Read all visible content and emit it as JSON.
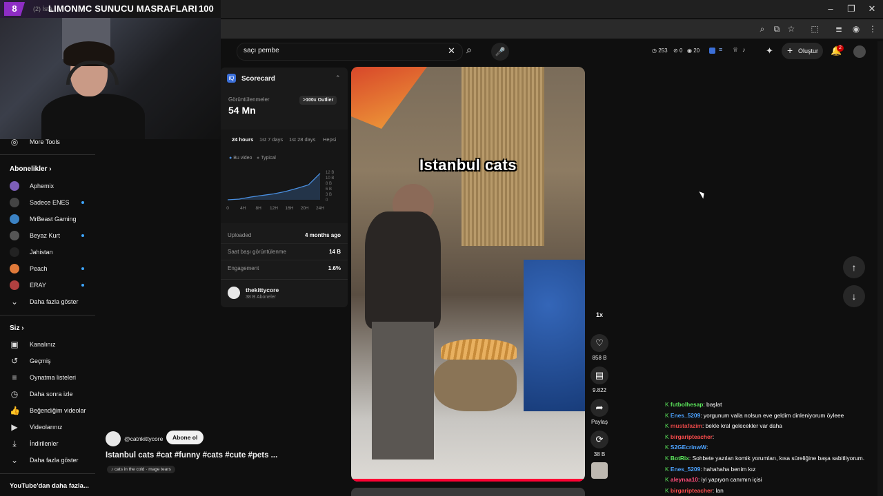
{
  "overlay": {
    "level": "8",
    "title": "LIMONMC SUNUCU MASRAFLARI",
    "count": "100",
    "tab_hint": "(2) İsta"
  },
  "window": {
    "minimize": "–",
    "restore": "❐",
    "close": "✕"
  },
  "search": {
    "query": "saçı pembe"
  },
  "header": {
    "stat1": "253",
    "stat2": "0",
    "stat3": "20",
    "create_label": "Oluştur",
    "notif_count": "2"
  },
  "scorecard": {
    "title": "Scorecard",
    "views_label": "Görüntülenmeler",
    "views_value": "54 Mn",
    "outlier_badge": ">100x Outlier",
    "tabs": [
      "24 hours",
      "1st 7 days",
      "1st 28 days",
      "Hepsi"
    ],
    "legend": [
      "Bu video",
      "Typical"
    ],
    "chart_data": {
      "type": "line",
      "x": [
        "0",
        "4H",
        "8H",
        "12H",
        "16H",
        "20H",
        "24H"
      ],
      "y_ticks": [
        "12 B",
        "10 B",
        "8 B",
        "6 B",
        "3 B",
        "0"
      ],
      "series": [
        {
          "name": "Bu video",
          "values": [
            0,
            0.3,
            1.2,
            1.9,
            2.6,
            3.6,
            5.0,
            6.5,
            11.5
          ]
        }
      ]
    },
    "rows": [
      {
        "label": "Uploaded",
        "value": "4 months ago"
      },
      {
        "label": "Saat başı görüntülenme",
        "value": "14 B"
      },
      {
        "label": "Engagement",
        "value": "1.6%"
      }
    ],
    "channel": {
      "name": "thekittycore",
      "subs": "38 B Aboneler"
    }
  },
  "sidebar": {
    "more_tools": "More Tools",
    "subs_header": "Abonelikler",
    "subs": [
      {
        "name": "Aphemix",
        "color": "#7d5fb8",
        "dot": false
      },
      {
        "name": "Sadece ENES",
        "color": "#444",
        "dot": true
      },
      {
        "name": "MrBeast Gaming",
        "color": "#3b82c4",
        "dot": false
      },
      {
        "name": "Beyaz Kurt",
        "color": "#555",
        "dot": true
      },
      {
        "name": "Jahistan",
        "color": "#222",
        "dot": false
      },
      {
        "name": "Peach",
        "color": "#e07a3a",
        "dot": true
      },
      {
        "name": "ERAY",
        "color": "#b04040",
        "dot": true
      }
    ],
    "show_more": "Daha fazla göster",
    "you_header": "Siz",
    "you_items": [
      {
        "label": "Kanalınız",
        "icon": "channel-icon",
        "glyph": "▣"
      },
      {
        "label": "Geçmiş",
        "icon": "history-icon",
        "glyph": "↺"
      },
      {
        "label": "Oynatma listeleri",
        "icon": "playlist-icon",
        "glyph": "≡"
      },
      {
        "label": "Daha sonra izle",
        "icon": "clock-icon",
        "glyph": "◷"
      },
      {
        "label": "Beğendiğim videolar",
        "icon": "thumbs-up-icon",
        "glyph": "👍"
      },
      {
        "label": "Videolarınız",
        "icon": "video-icon",
        "glyph": "▶"
      },
      {
        "label": "İndirilenler",
        "icon": "download-icon",
        "glyph": "⤓"
      },
      {
        "label": "Daha fazla göster",
        "icon": "chevron-down-icon",
        "glyph": "⌄"
      }
    ],
    "more_header": "YouTube'dan daha fazla..."
  },
  "video": {
    "caption": "Istanbul cats",
    "channel": "@catnkittycore",
    "subscribe": "Abone ol",
    "title": "Istanbul cats #cat #funny #cats #cute #pets ...",
    "music": "♪ cats in the cold · mage tears",
    "speed": "1x",
    "likes": "858 B",
    "comments": "9.822",
    "share": "Paylaş",
    "remix": "38 B"
  },
  "chat": [
    {
      "user": "futbolhesap",
      "ucolor": "#5ce65c",
      "msg": ": başlat"
    },
    {
      "user": "Enes_5209",
      "ucolor": "#4da3ff",
      "msg": ": yorgunum valla nolsun eve geldim dinleniyorum öyleee"
    },
    {
      "user": "mustafazim",
      "ucolor": "#e04646",
      "msg": ": bekle kral gelecekler var daha"
    },
    {
      "user": "birgaripteacher",
      "ucolor": "#ff4d4d",
      "msg": ":"
    },
    {
      "user": "S2GEcrinwW",
      "ucolor": "#4da3ff",
      "msg": ":"
    },
    {
      "user": "BotRix",
      "ucolor": "#5ce65c",
      "msg": ": Sohbete yazılan komik yorumları, kısa süreliğine başa sabitliyorum."
    },
    {
      "user": "Enes_5209",
      "ucolor": "#4da3ff",
      "msg": ": hahahaha benim kız"
    },
    {
      "user": "aleynaa10",
      "ucolor": "#ff4d7a",
      "msg": ": iyi yapıyon canımın içisi"
    },
    {
      "user": "birgaripteacher",
      "ucolor": "#ff4d4d",
      "msg": ": lan"
    }
  ]
}
